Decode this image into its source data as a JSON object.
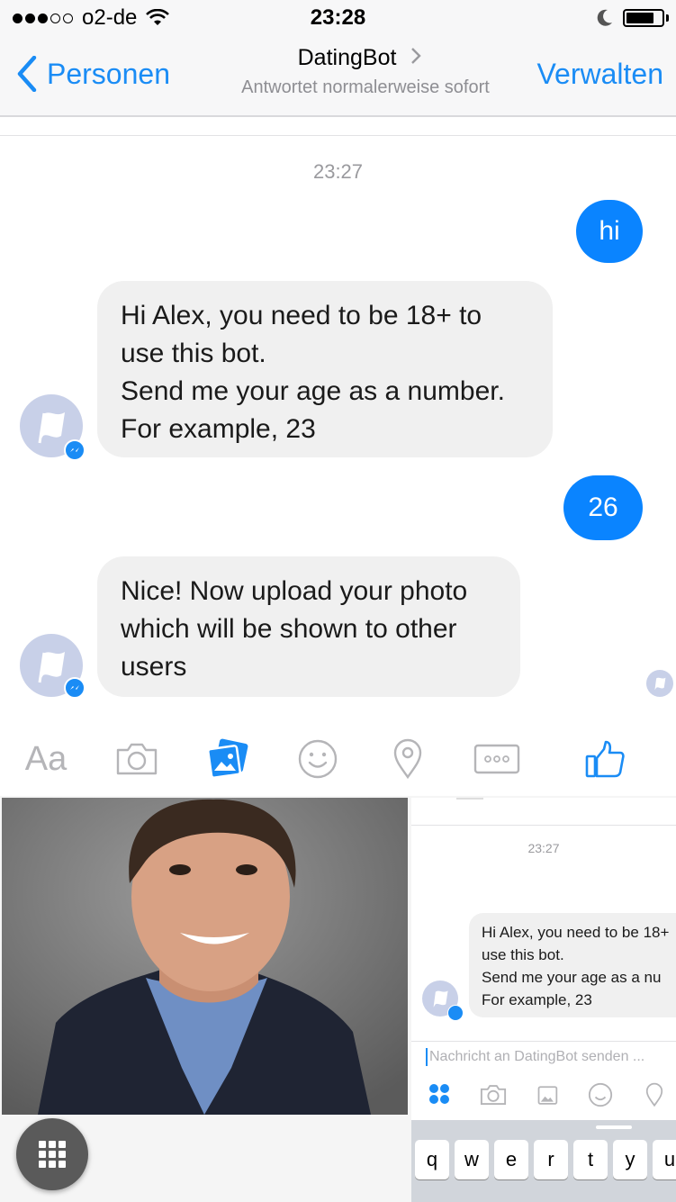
{
  "status_bar": {
    "carrier": "o2-de",
    "time": "23:28"
  },
  "nav": {
    "back_label": "Personen",
    "title": "DatingBot",
    "subtitle": "Antwortet normalerweise sofort",
    "manage_label": "Verwalten"
  },
  "conversation": {
    "timestamp": "23:27",
    "messages": [
      {
        "from": "user",
        "text": "hi"
      },
      {
        "from": "bot",
        "text": "Hi Alex, you need to be 18+ to\nuse this bot.\nSend me your age as a number.\nFor example, 23"
      },
      {
        "from": "user",
        "text": "26"
      },
      {
        "from": "bot",
        "text": "Nice! Now upload your photo\nwhich will be shown to other\nusers"
      }
    ]
  },
  "composer": {
    "text_icon_label": "Aa",
    "icons": [
      "camera-icon",
      "gallery-icon",
      "emoji-icon",
      "location-icon",
      "more-icon",
      "thumbs-up-icon"
    ]
  },
  "thumbnail": {
    "timestamp": "23:27",
    "bubble_text": "Hi Alex, you need to be 18+\nuse this bot.\nSend me your age as a nu\nFor example, 23",
    "input_placeholder": "Nachricht an DatingBot senden ...",
    "keys": [
      "q",
      "w",
      "e",
      "r",
      "t",
      "y",
      "u"
    ]
  },
  "colors": {
    "accent": "#1a8cf5",
    "bubble_out": "#0a84ff",
    "bubble_in": "#f0f0f0"
  }
}
